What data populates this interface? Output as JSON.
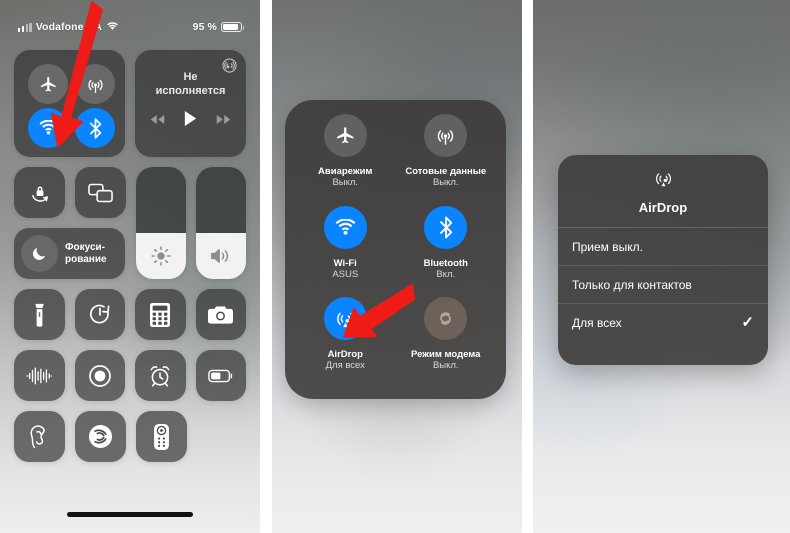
{
  "statusbar": {
    "carrier": "Vodafone UA",
    "battery_percent": "95 %",
    "signal_icon": "cellular-bars-icon",
    "wifi_icon": "wifi-icon",
    "battery_icon": "battery-icon"
  },
  "panel1": {
    "connectivity": {
      "airplane": {
        "label": "airplane-mode",
        "state": "off"
      },
      "cellular": {
        "label": "cellular-data",
        "state": "off"
      },
      "wifi": {
        "label": "wi-fi",
        "state": "on"
      },
      "bluetooth": {
        "label": "bluetooth",
        "state": "on"
      }
    },
    "media": {
      "now_playing_line1": "Не",
      "now_playing_line2": "исполняется",
      "airplay_icon": "airplay-icon",
      "prev_icon": "rewind-icon",
      "play_icon": "play-icon",
      "next_icon": "fast-forward-icon"
    },
    "tiles": {
      "rotation_lock": "rotation-lock-icon",
      "screen_mirroring": "screen-mirroring-icon",
      "focus_label_line1": "Фокуси-",
      "focus_label_line2": "рование",
      "focus_icon": "moon-icon",
      "brightness_icon": "brightness-icon",
      "volume_icon": "volume-icon",
      "flashlight": "flashlight-icon",
      "timer": "timer-icon",
      "calculator": "calculator-icon",
      "camera": "camera-icon",
      "sound_recognition": "sound-wave-icon",
      "screen_record": "screen-record-icon",
      "alarm": "alarm-clock-icon",
      "low_power": "low-power-battery-icon",
      "hearing": "hearing-ear-icon",
      "shazam": "shazam-icon",
      "remote": "apple-tv-remote-icon"
    },
    "brightness_level": 41,
    "volume_level": 41
  },
  "panel2": {
    "items": [
      {
        "name": "airplane-mode",
        "icon": "airplane-icon",
        "title": "Авиарежим",
        "sub": "Выкл.",
        "state": "off"
      },
      {
        "name": "cellular-data",
        "icon": "cellular-icon",
        "title": "Сотовые данные",
        "sub": "Выкл.",
        "state": "off"
      },
      {
        "name": "wi-fi",
        "icon": "wifi-icon",
        "title": "Wi-Fi",
        "sub": "ASUS",
        "state": "on"
      },
      {
        "name": "bluetooth",
        "icon": "bluetooth-icon",
        "title": "Bluetooth",
        "sub": "Вкл.",
        "state": "on"
      },
      {
        "name": "airdrop",
        "icon": "airdrop-icon",
        "title": "AirDrop",
        "sub": "Для всех",
        "state": "on"
      },
      {
        "name": "personal-hotspot",
        "icon": "hotspot-icon",
        "title": "Режим модема",
        "sub": "Выкл.",
        "state": "off"
      }
    ]
  },
  "panel3": {
    "dialog": {
      "icon": "airdrop-icon",
      "title": "AirDrop",
      "options": [
        {
          "label": "Прием выкл.",
          "selected": false,
          "check": ""
        },
        {
          "label": "Только для контактов",
          "selected": false,
          "check": ""
        },
        {
          "label": "Для всех",
          "selected": true,
          "check": "✓"
        }
      ]
    }
  },
  "annotations": {
    "arrow1": "red-arrow-pointing-to-wifi",
    "arrow2": "red-arrow-pointing-to-airdrop",
    "arrow_color": "#ee1b17"
  }
}
